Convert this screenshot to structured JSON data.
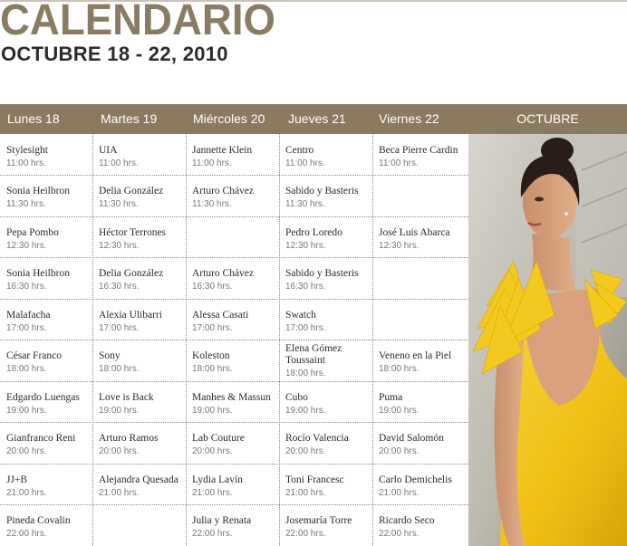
{
  "title": "CALENDARIO",
  "subtitle": "OCTUBRE 18 - 22, 2010",
  "header": {
    "days": [
      "Lunes 18",
      "Martes 19",
      "Miércoles 20",
      "Jueves 21",
      "Viernes 22"
    ],
    "month": "OCTUBRE"
  },
  "rows": [
    [
      [
        "Stylesight",
        "11:00 hrs."
      ],
      [
        "UIA",
        "11:00 hrs."
      ],
      [
        "Jannette Klein",
        "11:00 hrs."
      ],
      [
        "Centro",
        "11:00 hrs."
      ],
      [
        "Beca Pierre Cardin",
        "11:00 hrs."
      ]
    ],
    [
      [
        "Sonia Heilbron",
        "11:30 hrs."
      ],
      [
        "Delia González",
        "11:30 hrs."
      ],
      [
        "Arturo Chávez",
        "11:30 hrs."
      ],
      [
        "Sabido y Basteris",
        "11:30 hrs."
      ],
      [
        "",
        ""
      ]
    ],
    [
      [
        "Pepa Pombo",
        "12:30 hrs."
      ],
      [
        "Héctor Terrones",
        "12:30 hrs."
      ],
      [
        "",
        ""
      ],
      [
        "Pedro Loredo",
        "12:30 hrs."
      ],
      [
        "José Luis Abarca",
        "12:30 hrs."
      ]
    ],
    [
      [
        "Sonia Heilbron",
        "16:30 hrs."
      ],
      [
        "Delia González",
        "16:30 hrs."
      ],
      [
        "Arturo Chávez",
        "16:30 hrs."
      ],
      [
        "Sabido y Basteris",
        "16:30 hrs."
      ],
      [
        "",
        ""
      ]
    ],
    [
      [
        "Malafacha",
        "17:00 hrs."
      ],
      [
        "Alexia Ulibarri",
        "17:00 hrs."
      ],
      [
        "Alessa Casati",
        "17:00 hrs."
      ],
      [
        "Swatch",
        "17:00 hrs."
      ],
      [
        "",
        ""
      ]
    ],
    [
      [
        "César Franco",
        "18:00 hrs."
      ],
      [
        "Sony",
        "18:00 hrs."
      ],
      [
        "Koleston",
        "18:00 hrs."
      ],
      [
        "Elena Gómez Toussaint",
        "18:00 hrs."
      ],
      [
        "Veneno en la Piel",
        "18:00 hrs."
      ]
    ],
    [
      [
        "Edgardo Luengas",
        "19:00 hrs."
      ],
      [
        "Love is Back",
        "19:00 hrs."
      ],
      [
        "Manhes & Massun",
        "19:00 hrs."
      ],
      [
        "Cubo",
        "19:00 hrs."
      ],
      [
        "Puma",
        "19:00 hrs."
      ]
    ],
    [
      [
        "Gianfranco Reni",
        "20:00 hrs."
      ],
      [
        "Arturo Ramos",
        "20:00 hrs."
      ],
      [
        "Lab Couture",
        "20:00 hrs."
      ],
      [
        "Rocío Valencia",
        "20:00 hrs."
      ],
      [
        "David Salomón",
        "20:00 hrs."
      ]
    ],
    [
      [
        "JJ+B",
        "21:00 hrs."
      ],
      [
        "Alejandra Quesada",
        "21:00 hrs."
      ],
      [
        "Lydia Lavín",
        "21:00 hrs."
      ],
      [
        "Toni Francesc",
        "21:00 hrs."
      ],
      [
        "Carlo Demichelis",
        "21:00 hrs."
      ]
    ],
    [
      [
        "Pineda Covalin",
        "22:00 hrs."
      ],
      [
        "",
        ""
      ],
      [
        "Julia y Renata",
        "22:00 hrs."
      ],
      [
        "Josemaría Torre",
        "22:00 hrs."
      ],
      [
        "Ricardo Seco",
        "22:00 hrs."
      ]
    ]
  ],
  "colors": {
    "title": "#8a7c62",
    "header_bar": "#8b7b5e",
    "dress": "#f2c31a"
  }
}
